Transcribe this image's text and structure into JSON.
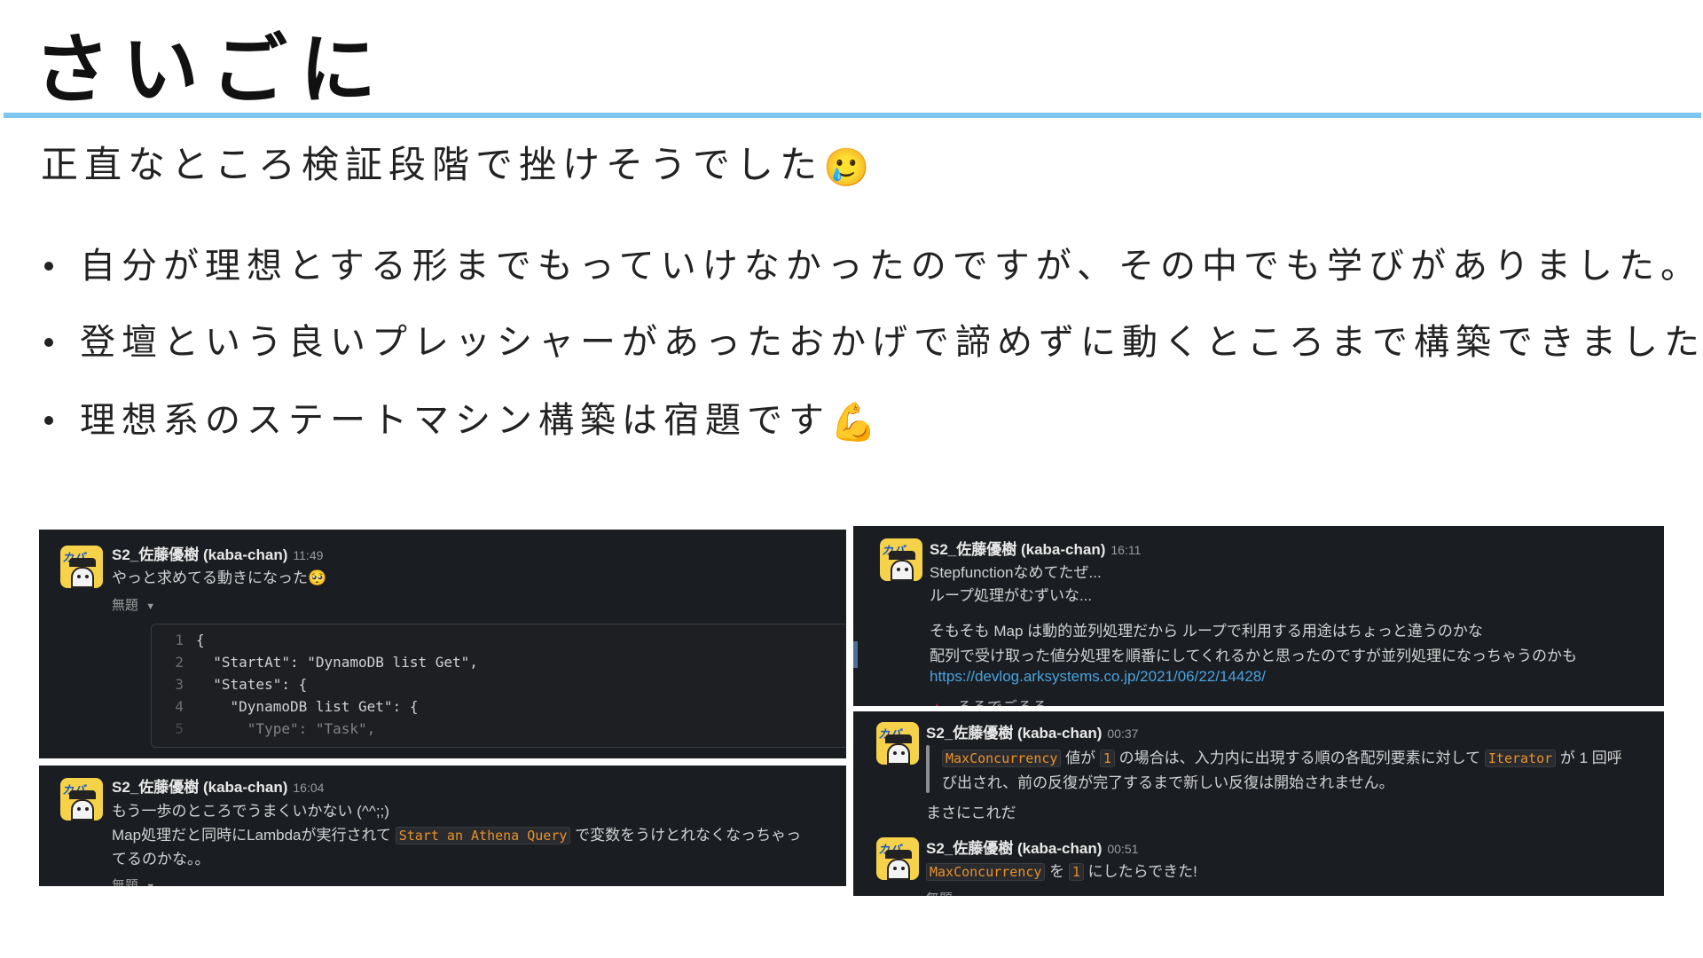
{
  "slide": {
    "title": "さいごに",
    "subtitle": "正直なところ検証段階で挫けそうでした",
    "subtitle_emoji": "🥲",
    "bullets": [
      {
        "text": "自分が理想とする形までもっていけなかったのですが、その中でも学びがありました。",
        "emoji": ""
      },
      {
        "text": "登壇という良いプレッシャーがあったおかげで諦めずに動くところまで構築できました。",
        "emoji": ""
      },
      {
        "text": "理想系のステートマシン構築は宿題です",
        "emoji": "💪"
      }
    ]
  },
  "panels": {
    "p1": {
      "user": "S2_佐藤優樹 (kaba-chan)",
      "time": "11:49",
      "text": "やっと求めてる動きになった",
      "emoji": "🥺",
      "attachment_label": "無題",
      "code_lines": [
        {
          "no": "1",
          "code": "{"
        },
        {
          "no": "2",
          "code": "  \"StartAt\": \"DynamoDB list Get\","
        },
        {
          "no": "3",
          "code": "  \"States\": {"
        },
        {
          "no": "4",
          "code": "    \"DynamoDB list Get\": {"
        },
        {
          "no": "5",
          "code": "      \"Type\": \"Task\","
        }
      ]
    },
    "p2": {
      "user": "S2_佐藤優樹 (kaba-chan)",
      "time": "16:04",
      "line1": "もう一歩のところでうまくいかない (^^;;)",
      "line2_a": "Map処理だと同時にLambdaが実行されて",
      "line2_code": "Start an Athena Query",
      "line2_b": "で変数をうけとれなくなっちゃっ",
      "line3": "てるのかな。。",
      "attachment_label": "無題"
    },
    "p3": {
      "user": "S2_佐藤優樹 (kaba-chan)",
      "time": "16:11",
      "line1": "Stepfunctionなめてたぜ...",
      "line2": "ループ処理がむずいな...",
      "line3": "そもそも Map は動的並列処理だから ループで利用する用途はちょっと違うのかな",
      "line4": "配列で受け取った値分処理を順番にしてくれるかと思ったのですが並列処理になっちゃうのかも",
      "link": "https://devlog.arksystems.co.jp/2021/06/22/14428/",
      "cut_text": "るるでごるる"
    },
    "p4": {
      "msg1": {
        "user": "S2_佐藤優樹 (kaba-chan)",
        "time": "00:37",
        "q_code1": "MaxConcurrency",
        "q_t1": "値が",
        "q_code2": "1",
        "q_t2": "の場合は、入力内に出現する順の各配列要素に対して",
        "q_code3": "Iterator",
        "q_t3": "が 1 回呼",
        "q_line2": "び出され、前の反復が完了するまで新しい反復は開始されません。",
        "line": "まさにこれだ"
      },
      "msg2": {
        "user": "S2_佐藤優樹 (kaba-chan)",
        "time": "00:51",
        "code1": "MaxConcurrency",
        "t1": "を",
        "code2": "1",
        "t2": "にしたらできた!",
        "cut_text": "無題"
      }
    }
  },
  "colors": {
    "accent_rule": "#7cc6ef",
    "panel_bg": "#1a1d21",
    "code_text": "#e8912d",
    "link": "#4aa3df"
  },
  "icons": {
    "avatar": "kaba-chan-avatar",
    "attachment_caret": "chevron-down-icon"
  }
}
